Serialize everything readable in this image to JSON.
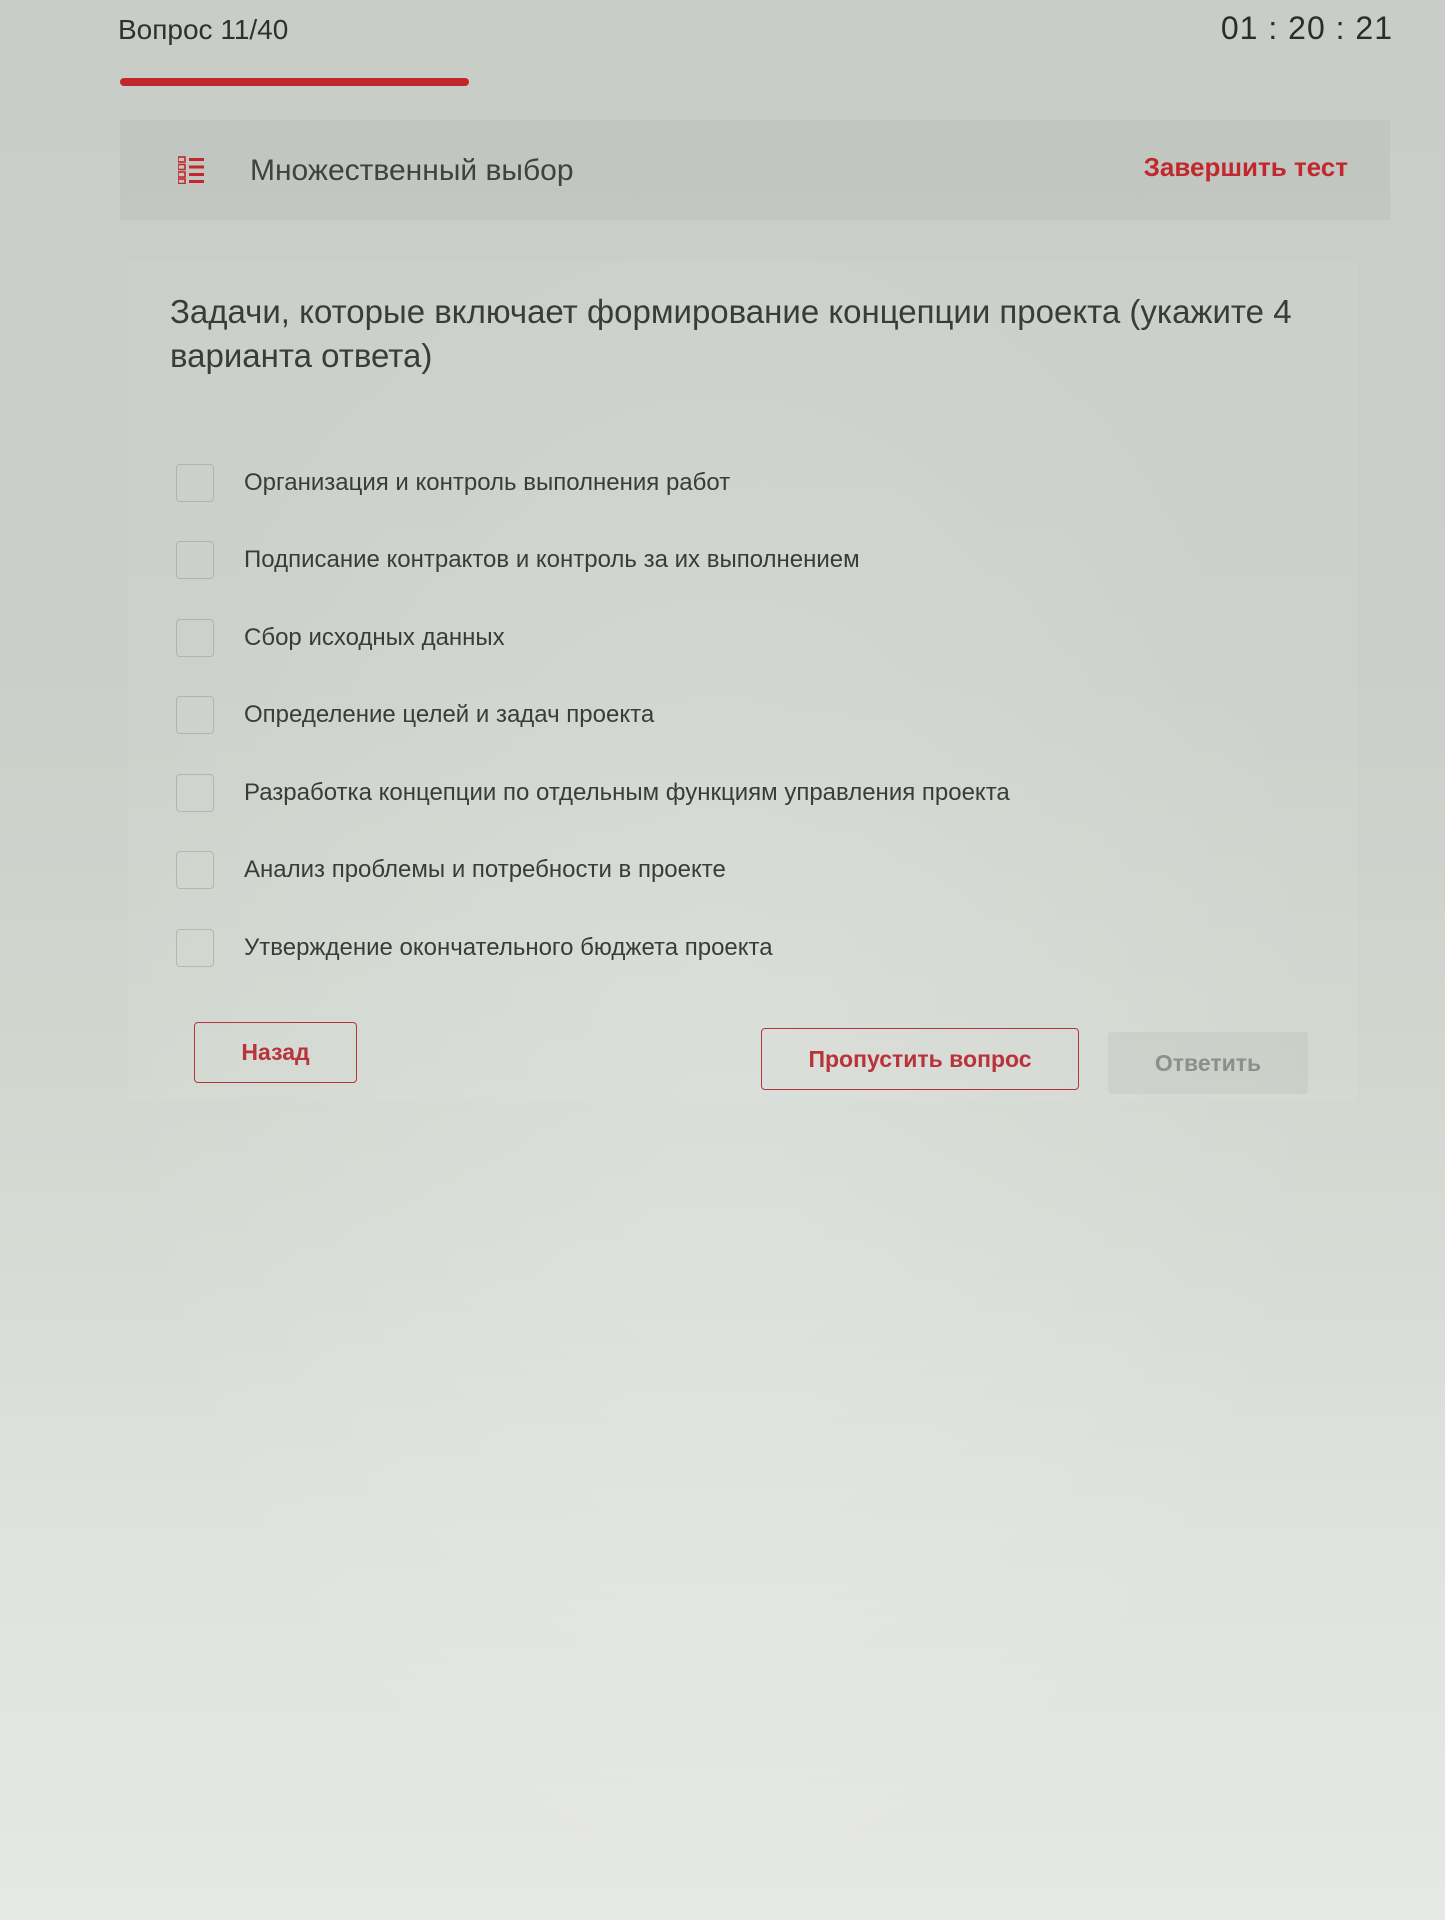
{
  "header": {
    "question_counter": "Вопрос 11/40",
    "timer": "01 : 20 : 21",
    "progress": {
      "current": 11,
      "total": 40
    }
  },
  "question_type": {
    "icon": "list-icon",
    "label": "Множественный выбор",
    "finish_label": "Завершить тест"
  },
  "question": {
    "text": "Задачи, которые включает формирование концепции проекта (укажите 4 варианта ответа)",
    "options": [
      {
        "label": "Организация и контроль выполнения работ",
        "checked": false
      },
      {
        "label": "Подписание контрактов и контроль за их выполнением",
        "checked": false
      },
      {
        "label": "Сбор исходных данных",
        "checked": false
      },
      {
        "label": "Определение целей и задач проекта",
        "checked": false
      },
      {
        "label": "Разработка концепции по отдельным функциям управления проекта",
        "checked": false
      },
      {
        "label": "Анализ проблемы и потребности в проекте",
        "checked": false
      },
      {
        "label": "Утверждение окончательного бюджета проекта",
        "checked": false
      }
    ]
  },
  "buttons": {
    "back": "Назад",
    "skip": "Пропустить вопрос",
    "answer": "Ответить"
  },
  "colors": {
    "accent": "#c1272d",
    "text": "#3a3c3a",
    "disabled": "#8c908c"
  }
}
